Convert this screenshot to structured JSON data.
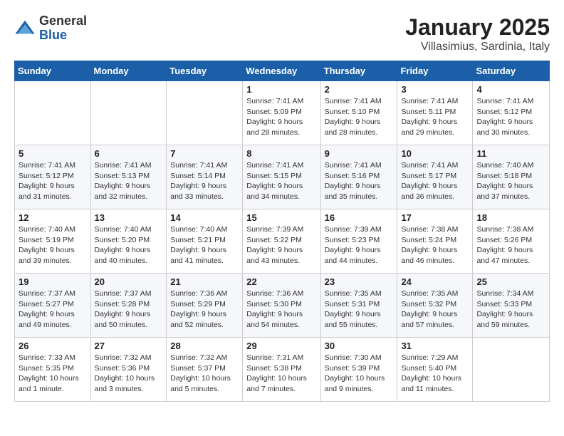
{
  "logo": {
    "general": "General",
    "blue": "Blue"
  },
  "title": "January 2025",
  "subtitle": "Villasimius, Sardinia, Italy",
  "days_of_week": [
    "Sunday",
    "Monday",
    "Tuesday",
    "Wednesday",
    "Thursday",
    "Friday",
    "Saturday"
  ],
  "weeks": [
    [
      {
        "day": "",
        "info": ""
      },
      {
        "day": "",
        "info": ""
      },
      {
        "day": "",
        "info": ""
      },
      {
        "day": "1",
        "info": "Sunrise: 7:41 AM\nSunset: 5:09 PM\nDaylight: 9 hours and 28 minutes."
      },
      {
        "day": "2",
        "info": "Sunrise: 7:41 AM\nSunset: 5:10 PM\nDaylight: 9 hours and 28 minutes."
      },
      {
        "day": "3",
        "info": "Sunrise: 7:41 AM\nSunset: 5:11 PM\nDaylight: 9 hours and 29 minutes."
      },
      {
        "day": "4",
        "info": "Sunrise: 7:41 AM\nSunset: 5:12 PM\nDaylight: 9 hours and 30 minutes."
      }
    ],
    [
      {
        "day": "5",
        "info": "Sunrise: 7:41 AM\nSunset: 5:12 PM\nDaylight: 9 hours and 31 minutes."
      },
      {
        "day": "6",
        "info": "Sunrise: 7:41 AM\nSunset: 5:13 PM\nDaylight: 9 hours and 32 minutes."
      },
      {
        "day": "7",
        "info": "Sunrise: 7:41 AM\nSunset: 5:14 PM\nDaylight: 9 hours and 33 minutes."
      },
      {
        "day": "8",
        "info": "Sunrise: 7:41 AM\nSunset: 5:15 PM\nDaylight: 9 hours and 34 minutes."
      },
      {
        "day": "9",
        "info": "Sunrise: 7:41 AM\nSunset: 5:16 PM\nDaylight: 9 hours and 35 minutes."
      },
      {
        "day": "10",
        "info": "Sunrise: 7:41 AM\nSunset: 5:17 PM\nDaylight: 9 hours and 36 minutes."
      },
      {
        "day": "11",
        "info": "Sunrise: 7:40 AM\nSunset: 5:18 PM\nDaylight: 9 hours and 37 minutes."
      }
    ],
    [
      {
        "day": "12",
        "info": "Sunrise: 7:40 AM\nSunset: 5:19 PM\nDaylight: 9 hours and 39 minutes."
      },
      {
        "day": "13",
        "info": "Sunrise: 7:40 AM\nSunset: 5:20 PM\nDaylight: 9 hours and 40 minutes."
      },
      {
        "day": "14",
        "info": "Sunrise: 7:40 AM\nSunset: 5:21 PM\nDaylight: 9 hours and 41 minutes."
      },
      {
        "day": "15",
        "info": "Sunrise: 7:39 AM\nSunset: 5:22 PM\nDaylight: 9 hours and 43 minutes."
      },
      {
        "day": "16",
        "info": "Sunrise: 7:39 AM\nSunset: 5:23 PM\nDaylight: 9 hours and 44 minutes."
      },
      {
        "day": "17",
        "info": "Sunrise: 7:38 AM\nSunset: 5:24 PM\nDaylight: 9 hours and 46 minutes."
      },
      {
        "day": "18",
        "info": "Sunrise: 7:38 AM\nSunset: 5:26 PM\nDaylight: 9 hours and 47 minutes."
      }
    ],
    [
      {
        "day": "19",
        "info": "Sunrise: 7:37 AM\nSunset: 5:27 PM\nDaylight: 9 hours and 49 minutes."
      },
      {
        "day": "20",
        "info": "Sunrise: 7:37 AM\nSunset: 5:28 PM\nDaylight: 9 hours and 50 minutes."
      },
      {
        "day": "21",
        "info": "Sunrise: 7:36 AM\nSunset: 5:29 PM\nDaylight: 9 hours and 52 minutes."
      },
      {
        "day": "22",
        "info": "Sunrise: 7:36 AM\nSunset: 5:30 PM\nDaylight: 9 hours and 54 minutes."
      },
      {
        "day": "23",
        "info": "Sunrise: 7:35 AM\nSunset: 5:31 PM\nDaylight: 9 hours and 55 minutes."
      },
      {
        "day": "24",
        "info": "Sunrise: 7:35 AM\nSunset: 5:32 PM\nDaylight: 9 hours and 57 minutes."
      },
      {
        "day": "25",
        "info": "Sunrise: 7:34 AM\nSunset: 5:33 PM\nDaylight: 9 hours and 59 minutes."
      }
    ],
    [
      {
        "day": "26",
        "info": "Sunrise: 7:33 AM\nSunset: 5:35 PM\nDaylight: 10 hours and 1 minute."
      },
      {
        "day": "27",
        "info": "Sunrise: 7:32 AM\nSunset: 5:36 PM\nDaylight: 10 hours and 3 minutes."
      },
      {
        "day": "28",
        "info": "Sunrise: 7:32 AM\nSunset: 5:37 PM\nDaylight: 10 hours and 5 minutes."
      },
      {
        "day": "29",
        "info": "Sunrise: 7:31 AM\nSunset: 5:38 PM\nDaylight: 10 hours and 7 minutes."
      },
      {
        "day": "30",
        "info": "Sunrise: 7:30 AM\nSunset: 5:39 PM\nDaylight: 10 hours and 9 minutes."
      },
      {
        "day": "31",
        "info": "Sunrise: 7:29 AM\nSunset: 5:40 PM\nDaylight: 10 hours and 11 minutes."
      },
      {
        "day": "",
        "info": ""
      }
    ]
  ]
}
